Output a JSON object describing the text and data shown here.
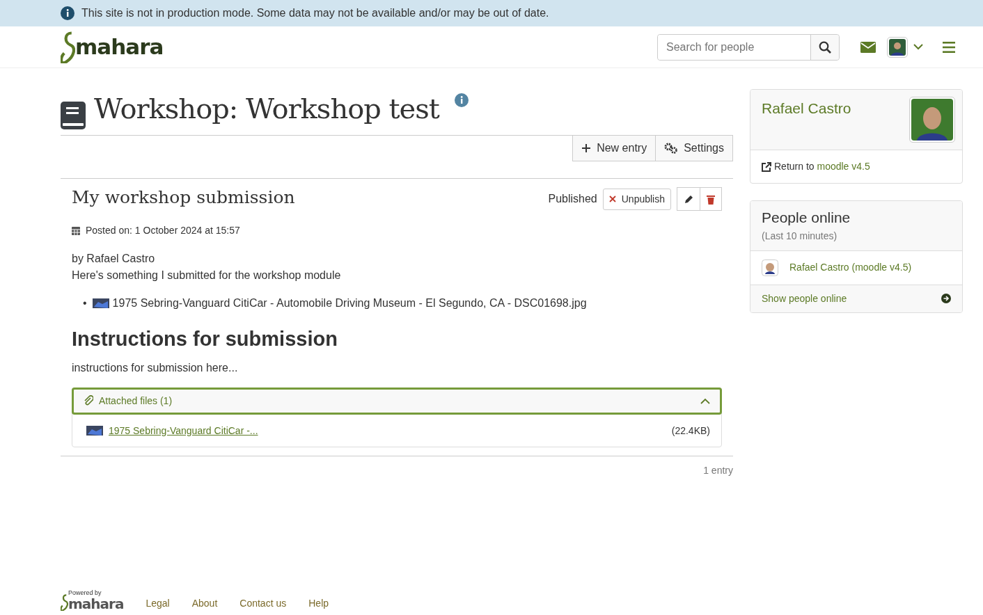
{
  "alert": {
    "text": "This site is not in production mode. Some data may not be available and/or may be out of date."
  },
  "header": {
    "logo": "mahara",
    "search": {
      "placeholder": "Search for people"
    }
  },
  "page": {
    "title": "Workshop: Workshop test",
    "buttons": [
      {
        "kind": "add",
        "label": "New entry"
      },
      {
        "kind": "settings",
        "label": "Settings"
      }
    ]
  },
  "entry": {
    "title": "My workshop submission",
    "status": "Published",
    "unpublish": "Unpublish",
    "posted": "Posted on: 1 October 2024 at 15:57",
    "author": "by Rafael Castro",
    "body": "Here's something I submitted for the workshop module",
    "list_marker": "•",
    "list_items": [
      "1975 Sebring-Vanguard CitiCar - Automobile Driving Museum - El Segundo, CA - DSC01698.jpg"
    ],
    "heading": "Instructions for submission",
    "instructions": "instructions for submission here...",
    "attachments": {
      "title": "Attached files",
      "count": "(1)",
      "expanded": true,
      "files": [
        {
          "name": "1975 Sebring-Vanguard CitiCar -...",
          "size": "(22.4KB)"
        }
      ]
    }
  },
  "entry_count": "1 entry",
  "sidebar": {
    "profile": {
      "name": "Rafael Castro",
      "return_prefix": "Return to",
      "return_link": "moodle v4.5"
    },
    "online": {
      "title": "People online",
      "subtitle": "(Last 10 minutes)",
      "people": [
        "Rafael Castro (moodle v4.5)"
      ],
      "footer": "Show people online"
    }
  },
  "footer": {
    "powered": "Powered by",
    "logo": "mahara",
    "links": [
      "Legal",
      "About",
      "Contact us",
      "Help"
    ]
  }
}
